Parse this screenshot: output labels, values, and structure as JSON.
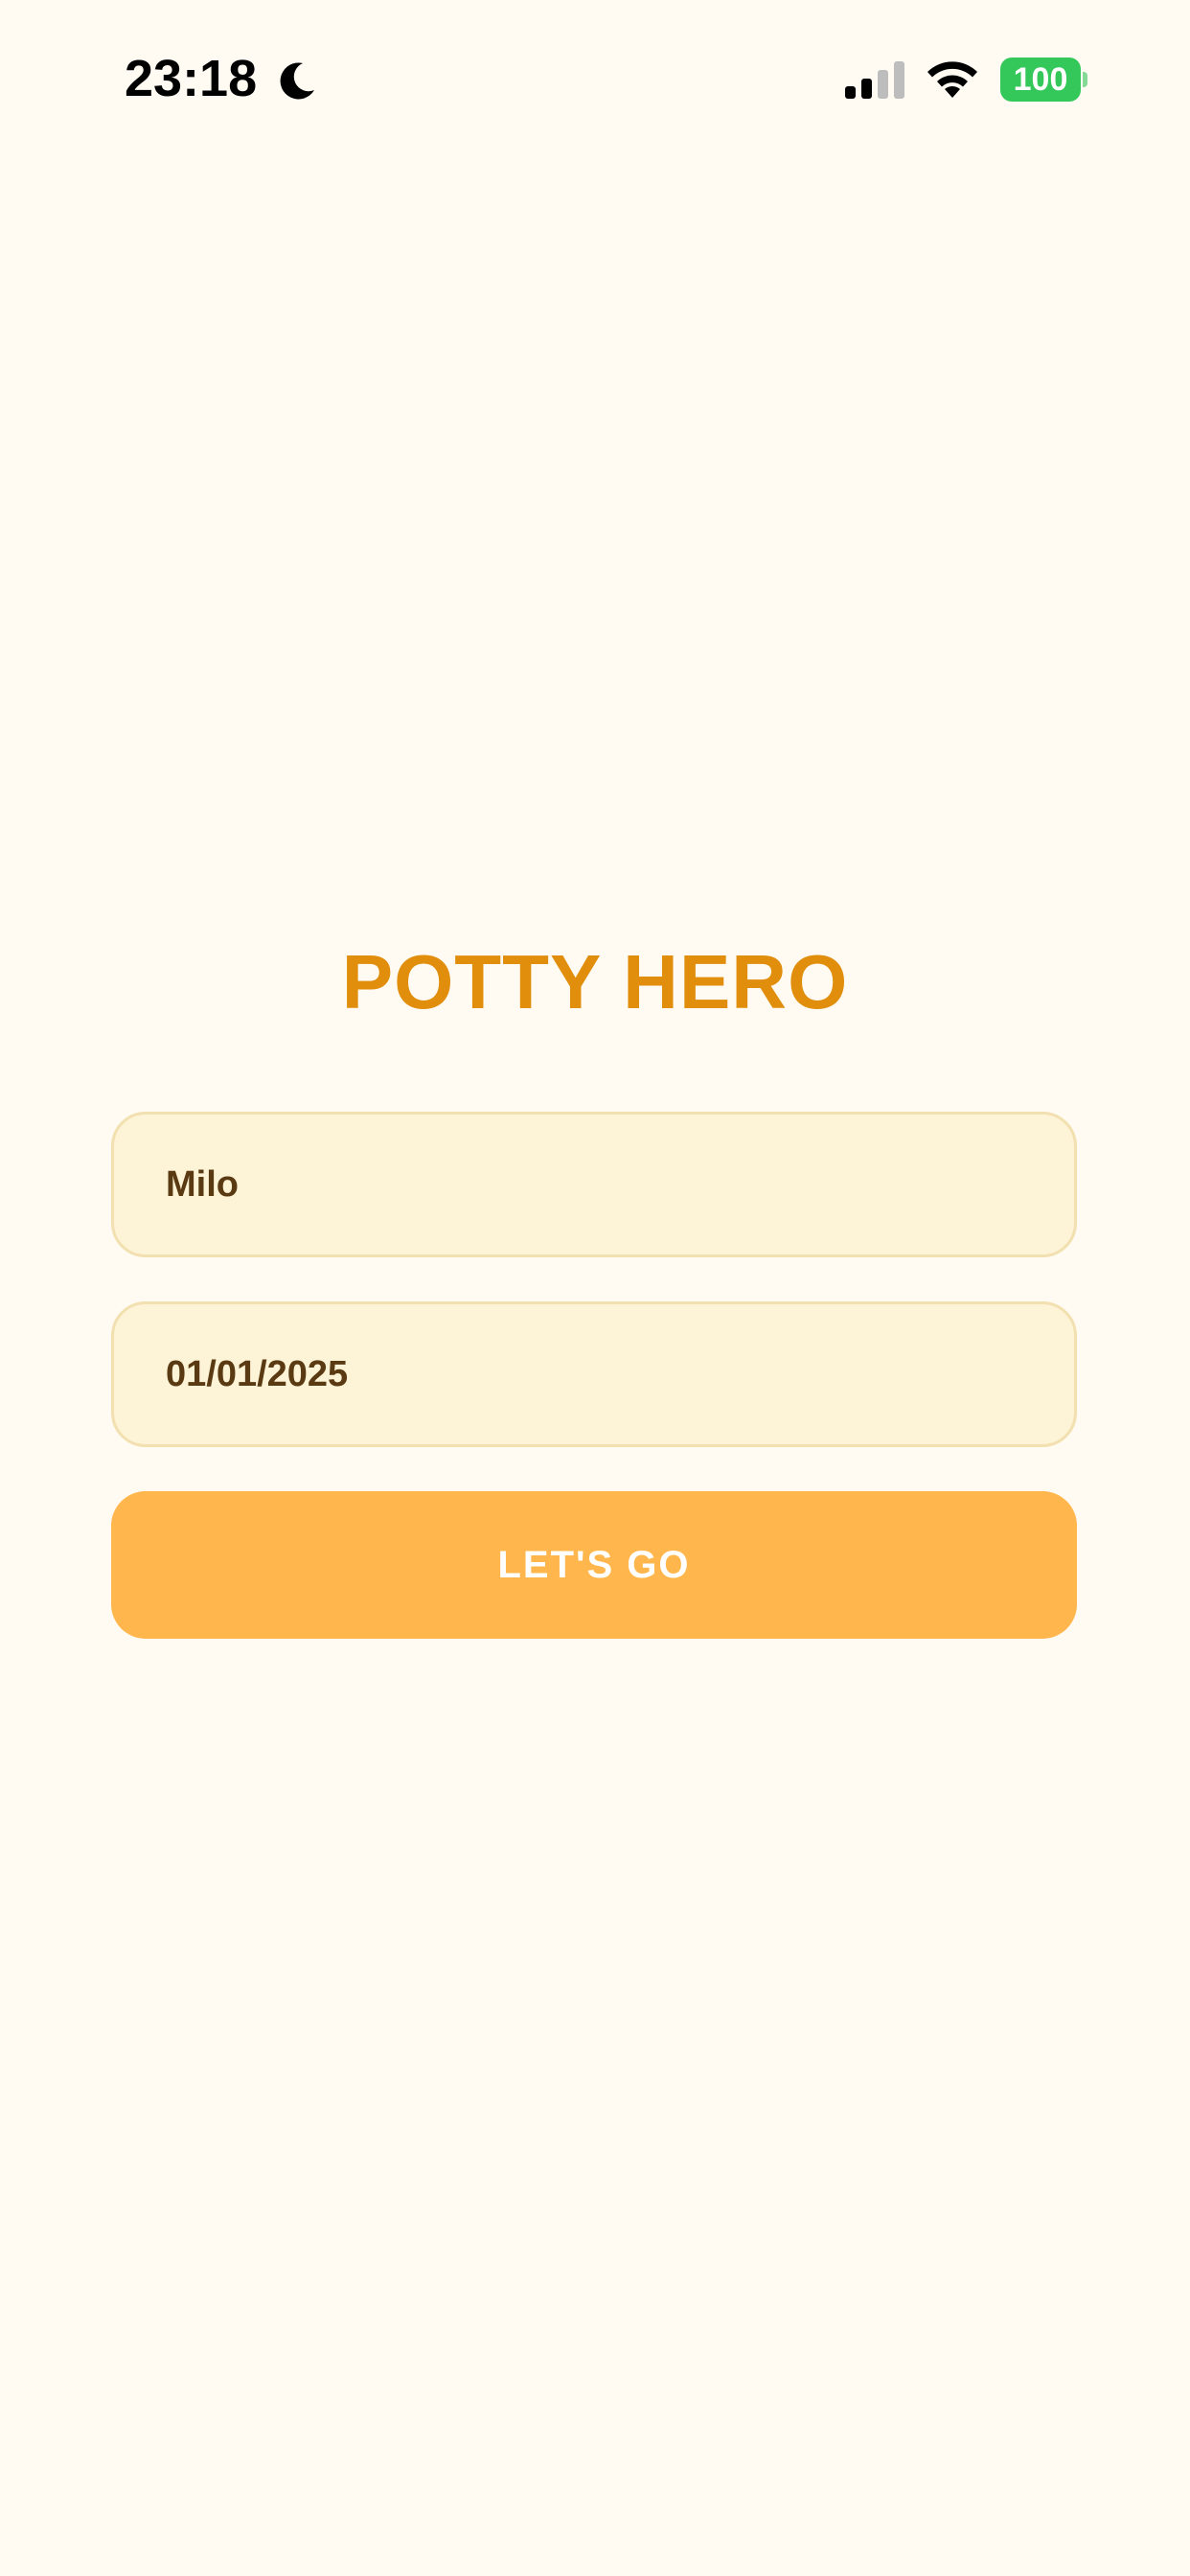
{
  "status_bar": {
    "time": "23:18",
    "battery_level": "100",
    "icons": [
      "moon-icon",
      "signal-icon",
      "wifi-icon",
      "battery-icon"
    ],
    "battery_color": "#34C759"
  },
  "app": {
    "title": "POTTY HERO",
    "title_color": "#E08E0B",
    "background_color": "#FFFBF3"
  },
  "form": {
    "name_value": "Milo",
    "date_value": "01/01/2025",
    "field_background": "#FDF3D6",
    "field_border": "#F2E0B0"
  },
  "button": {
    "label": "LET'S GO",
    "background_color": "#FFB74D"
  }
}
